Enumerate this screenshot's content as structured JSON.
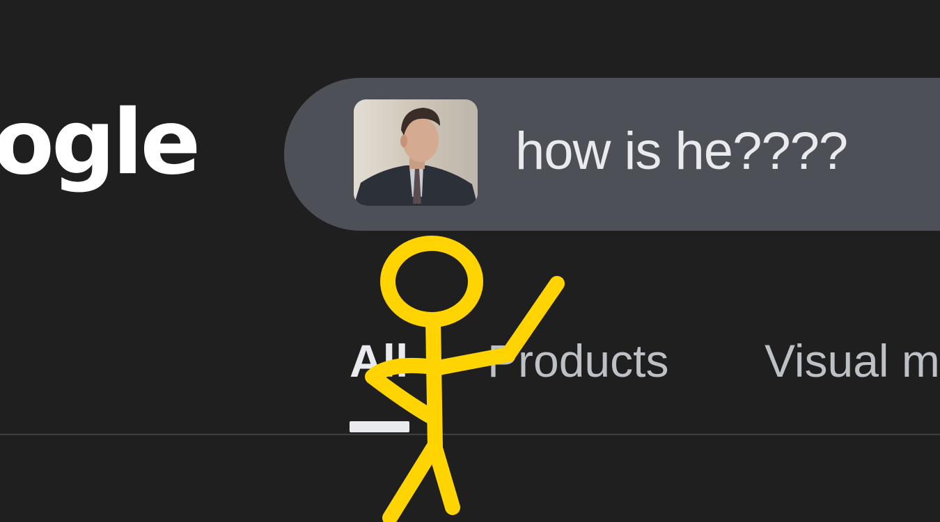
{
  "logo": {
    "text": "ogle"
  },
  "search": {
    "query": "how is he????",
    "thumbnail_icon": "person-photo-thumbnail"
  },
  "tabs": [
    {
      "label": "All",
      "selected": true
    },
    {
      "label": "Products",
      "selected": false
    },
    {
      "label": "Visual m",
      "selected": false
    }
  ],
  "annotation": {
    "icon": "stick-figure-drawing",
    "color": "#ffd400"
  },
  "colors": {
    "background": "#1f1f1f",
    "search_bar": "#4d5057",
    "text_primary": "#e8eaed",
    "text_secondary": "#bdc1c6"
  }
}
